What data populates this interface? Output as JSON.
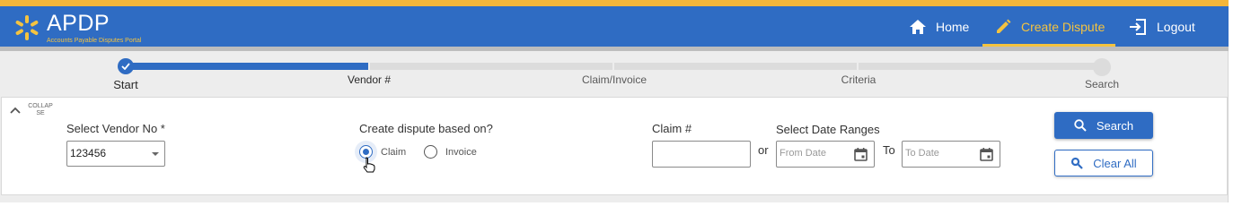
{
  "header": {
    "logo_title": "APDP",
    "logo_subtitle": "Accounts Payable Disputes Portal",
    "nav": [
      {
        "label": "Home",
        "icon": "home-icon"
      },
      {
        "label": "Create Dispute",
        "icon": "pencil-icon",
        "active": true
      },
      {
        "label": "Logout",
        "icon": "logout-icon"
      }
    ],
    "colors": {
      "primary": "#2f6cc3",
      "accent": "#f4b63a"
    }
  },
  "stepper": {
    "steps": [
      "Start",
      "Vendor #",
      "Claim/Invoice",
      "Criteria",
      "Search"
    ],
    "current_step": "Vendor #",
    "completed_fraction": 0.25
  },
  "panel": {
    "collapse_label_line1": "COLLAP",
    "collapse_label_line2": "SE",
    "vendor": {
      "label": "Select Vendor No *",
      "value": "123456"
    },
    "dispute_basis": {
      "label": "Create dispute based on?",
      "options": [
        "Claim",
        "Invoice"
      ],
      "selected": "Claim"
    },
    "claim": {
      "label": "Claim #",
      "value": ""
    },
    "or_label": "or",
    "dates": {
      "label": "Select Date Ranges",
      "from_placeholder": "From Date",
      "to_label": "To",
      "to_placeholder": "To Date"
    },
    "search_button": "Search",
    "clear_button": "Clear All"
  }
}
